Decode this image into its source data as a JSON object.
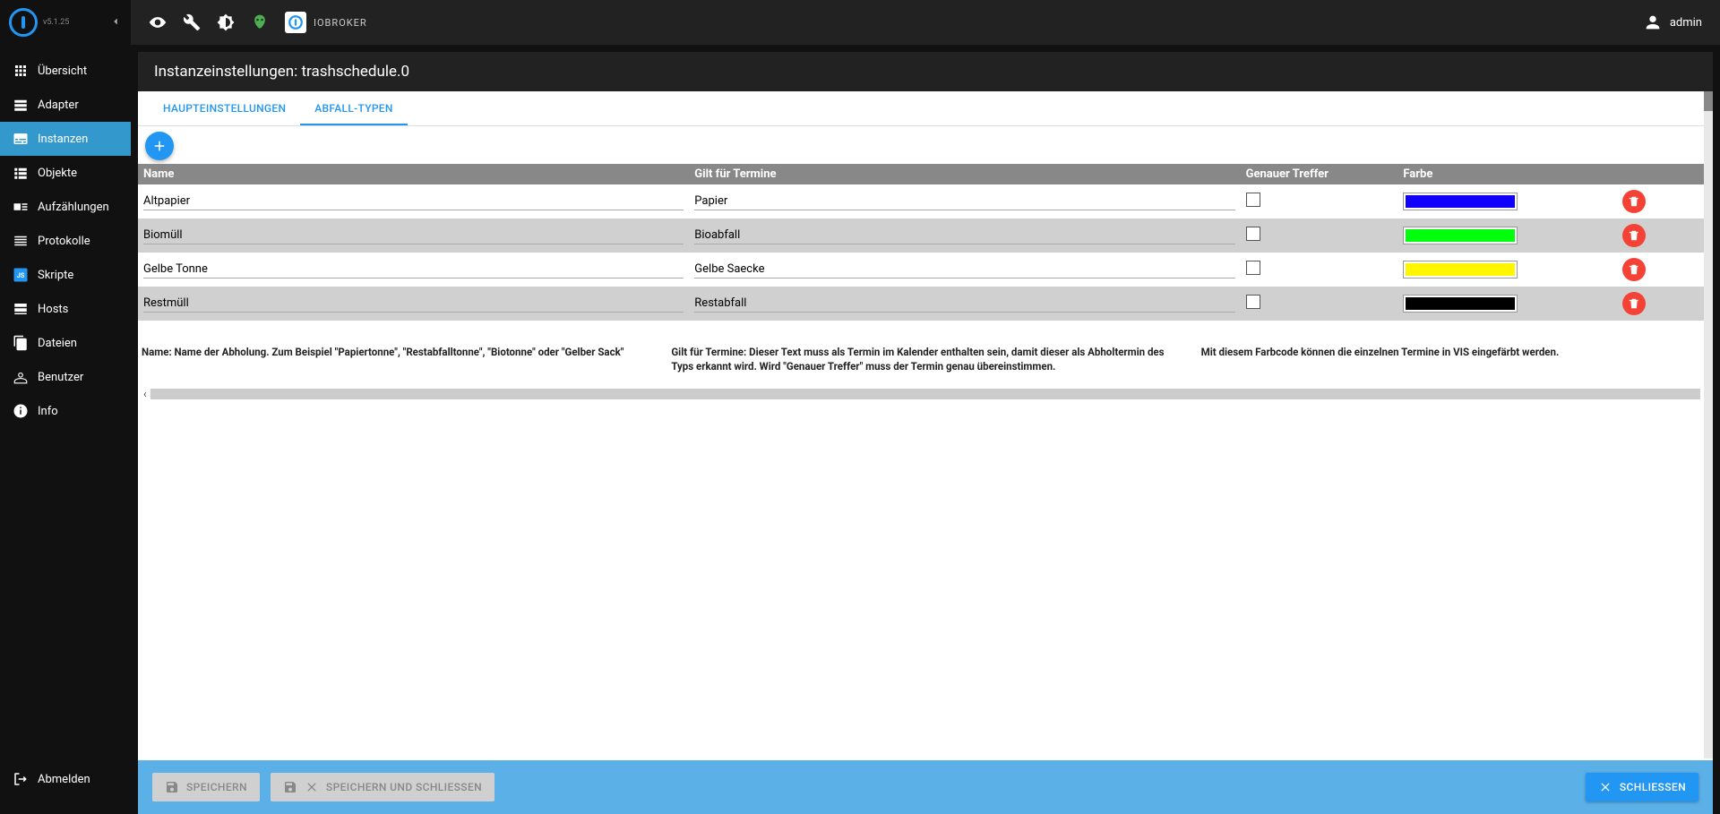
{
  "version": "v5.1.25",
  "brand": "IOBROKER",
  "user": "admin",
  "nav": {
    "items": [
      {
        "label": "Übersicht"
      },
      {
        "label": "Adapter"
      },
      {
        "label": "Instanzen"
      },
      {
        "label": "Objekte"
      },
      {
        "label": "Aufzählungen"
      },
      {
        "label": "Protokolle"
      },
      {
        "label": "Skripte"
      },
      {
        "label": "Hosts"
      },
      {
        "label": "Dateien"
      },
      {
        "label": "Benutzer"
      },
      {
        "label": "Info"
      }
    ],
    "logout": "Abmelden"
  },
  "panel": {
    "title": "Instanzeinstellungen: trashschedule.0"
  },
  "tabs": [
    {
      "label": "HAUPTEINSTELLUNGEN"
    },
    {
      "label": "ABFALL-TYPEN"
    }
  ],
  "table": {
    "headers": {
      "name": "Name",
      "match": "Gilt für Termine",
      "exact": "Genauer Treffer",
      "color": "Farbe"
    },
    "rows": [
      {
        "name": "Altpapier",
        "match": "Papier",
        "exact": false,
        "color": "#1200ff"
      },
      {
        "name": "Biomüll",
        "match": "Bioabfall",
        "exact": false,
        "color": "#00ff0c"
      },
      {
        "name": "Gelbe Tonne",
        "match": "Gelbe Saecke",
        "exact": false,
        "color": "#fff600"
      },
      {
        "name": "Restmüll",
        "match": "Restabfall",
        "exact": false,
        "color": "#000000"
      }
    ]
  },
  "help": {
    "name": "Name: Name der Abholung. Zum Beispiel \"Papiertonne\", \"Restabfalltonne\", \"Biotonne\" oder \"Gelber Sack\"",
    "match": "Gilt für Termine: Dieser Text muss als Termin im Kalender enthalten sein, damit dieser als Abholtermin des Typs erkannt wird. Wird \"Genauer Treffer\" muss der Termin genau übereinstimmen.",
    "color": "Mit diesem Farbcode können die einzelnen Termine in VIS eingefärbt werden."
  },
  "footer": {
    "save": "SPEICHERN",
    "save_close": "SPEICHERN UND SCHLIESSEN",
    "close": "SCHLIESSEN"
  }
}
